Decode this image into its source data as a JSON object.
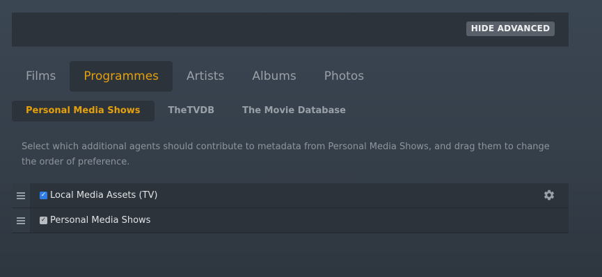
{
  "header": {
    "hide_advanced_label": "HIDE ADVANCED"
  },
  "tabs": [
    {
      "label": "Films",
      "active": false
    },
    {
      "label": "Programmes",
      "active": true
    },
    {
      "label": "Artists",
      "active": false
    },
    {
      "label": "Albums",
      "active": false
    },
    {
      "label": "Photos",
      "active": false
    }
  ],
  "subtabs": [
    {
      "label": "Personal Media Shows",
      "active": true
    },
    {
      "label": "TheTVDB",
      "active": false
    },
    {
      "label": "The Movie Database",
      "active": false
    }
  ],
  "description": "Select which additional agents should contribute to metadata from Personal Media Shows, and drag them to change the order of preference.",
  "agents": [
    {
      "label": "Local Media Assets (TV)",
      "checked": true,
      "has_settings": true
    },
    {
      "label": "Personal Media Shows",
      "checked": true,
      "has_settings": false
    }
  ],
  "icons": {
    "drag": "drag-handle-icon",
    "settings": "gear-icon",
    "check": "checkmark-icon"
  },
  "colors": {
    "accent": "#e5a00d",
    "checkbox_blue": "#2f7ee6",
    "panel": "#2c333b"
  }
}
